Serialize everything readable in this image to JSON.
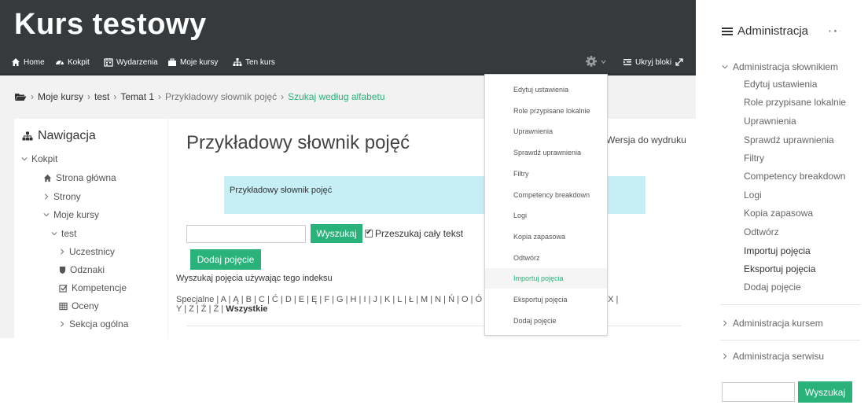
{
  "header": {
    "site_title": "Kurs testowy",
    "nav": {
      "home": "Home",
      "dashboard": "Kokpit",
      "events": "Wydarzenia",
      "my_courses": "Moje kursy",
      "this_course": "Ten kurs",
      "hide_blocks": "Ukryj bloki"
    },
    "accent_color": "#2ab27b",
    "header_color": "#373a3c"
  },
  "breadcrumb": {
    "sep": "›",
    "items": [
      "Moje kursy",
      "test",
      "Temat 1",
      "Przykładowy słownik pojęć",
      "Szukaj według alfabetu"
    ]
  },
  "navigation": {
    "title": "Nawigacja",
    "dashboard": "Kokpit",
    "home": "Strona główna",
    "pages": "Strony",
    "my_courses": "Moje kursy",
    "course": "test",
    "participants": "Uczestnicy",
    "badges": "Odznaki",
    "competencies": "Kompetencje",
    "grades": "Oceny",
    "general": "Sekcja ogólna"
  },
  "main": {
    "title": "Przykładowy słownik pojęć",
    "print_link": "Wersja do wydruku",
    "description": "Przykładowy słownik pojęć",
    "search_button": "Wyszukaj",
    "fulltext_label": "Przeszukaj cały tekst",
    "add_button": "Dodaj pojęcie",
    "index_label": "Wyszukaj pojęcia używając tego indeksu",
    "alphabet_line1": "Specjalne | A | Ą | B | C | Ć | D | E | Ę | F | G | H | I | J | K | L | Ł | M | N | Ń | O | Ó | P | Q | R | S | Ś | T | U | V | W | X |",
    "alphabet_line2": "Y | Z | Ź | Ż | ",
    "alphabet_all": "Wszystkie"
  },
  "dropdown": {
    "items": [
      "Edytuj ustawienia",
      "Role przypisane lokalnie",
      "Uprawnienia",
      "Sprawdź uprawnienia",
      "Filtry",
      "Competency breakdown",
      "Logi",
      "Kopia zapasowa",
      "Odtwórz",
      "Importuj pojęcia",
      "Eksportuj pojęcia",
      "Dodaj pojęcie"
    ]
  },
  "admin": {
    "title": "Administracja",
    "glossary_admin": "Administracja słownikiem",
    "items": [
      "Edytuj ustawienia",
      "Role przypisane lokalnie",
      "Uprawnienia",
      "Sprawdź uprawnienia",
      "Filtry",
      "Competency breakdown",
      "Logi",
      "Kopia zapasowa",
      "Odtwórz",
      "Importuj pojęcia",
      "Eksportuj pojęcia",
      "Dodaj pojęcie"
    ],
    "course_admin": "Administracja kursem",
    "site_admin": "Administracja serwisu",
    "search_button": "Wyszukaj"
  }
}
